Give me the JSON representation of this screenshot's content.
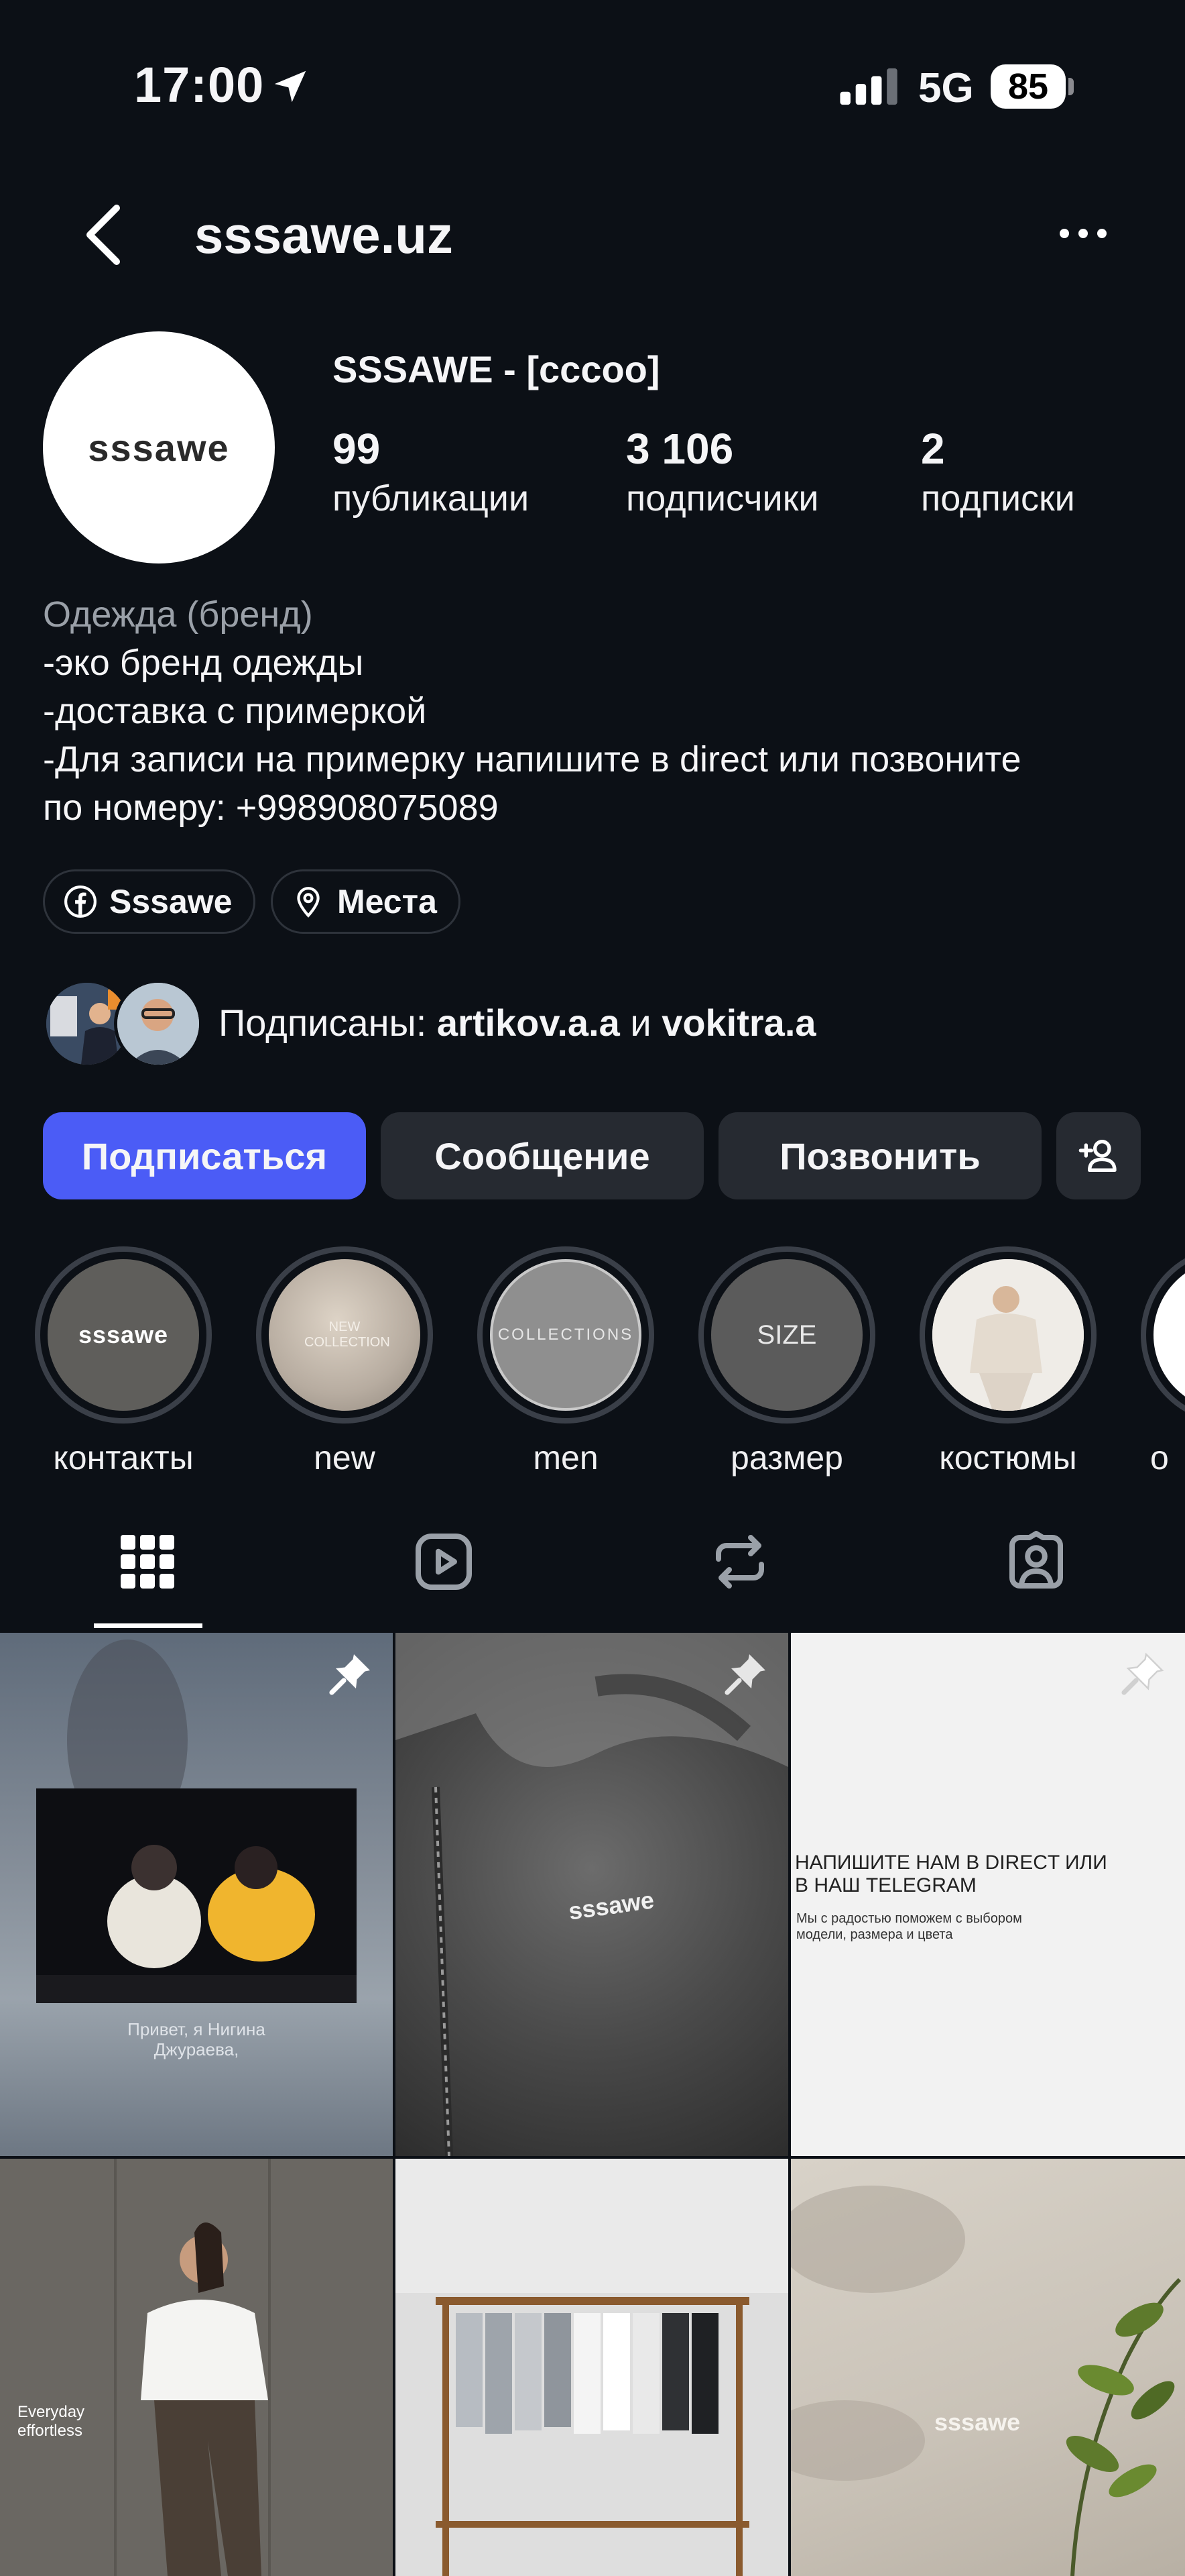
{
  "status_bar": {
    "time": "17:00",
    "network": "5G",
    "battery": "85"
  },
  "header": {
    "username": "sssawe.uz"
  },
  "profile": {
    "avatar_text": "sssawe",
    "name": "SSSAWE - [cccoo]",
    "stats": [
      {
        "value": "99",
        "label": "публикации"
      },
      {
        "value": "3 106",
        "label": "подписчики"
      },
      {
        "value": "2",
        "label": "подписки"
      }
    ]
  },
  "bio": {
    "category": "Одежда (бренд)",
    "lines": [
      "-эко бренд одежды",
      "-доставка с примеркой",
      "-Для записи на примерку напишите в direct или позвоните",
      "по номеру: +998908075089"
    ]
  },
  "chips": {
    "facebook": "Sssawe",
    "places": "Места"
  },
  "followed_by": {
    "prefix": "Подписаны: ",
    "user1": "artikov.a.a",
    "joiner": " и ",
    "user2": "vokitra.a"
  },
  "actions": {
    "follow": "Подписаться",
    "message": "Сообщение",
    "call": "Позвонить"
  },
  "highlights": [
    {
      "label": "контакты",
      "inner_text": "sssawe"
    },
    {
      "label": "new",
      "inner_text": "NEW COLLECTION"
    },
    {
      "label": "men",
      "inner_text": "COLLECTIONS"
    },
    {
      "label": "размер",
      "inner_text": "SIZE"
    },
    {
      "label": "костюмы",
      "inner_text": ""
    },
    {
      "label": "о",
      "inner_text": ""
    }
  ],
  "posts": {
    "post1_caption": "Привет, я Нигина\nДжураева,",
    "post2_logo": "sssawe",
    "post3_title": "НАПИШИТЕ НАМ В DIRECT ИЛИ\nВ НАШ TELEGRAM",
    "post3_body": "Мы с радостью поможем с выбором\nмодели, размера и цвета",
    "post4_caption": "Everyday\neffortless",
    "post6_logo": "sssawe"
  },
  "colors": {
    "background": "#0c1016",
    "primary_button": "#4b5cf6",
    "secondary_button": "#262a31",
    "muted_text": "#9aa0a8"
  }
}
